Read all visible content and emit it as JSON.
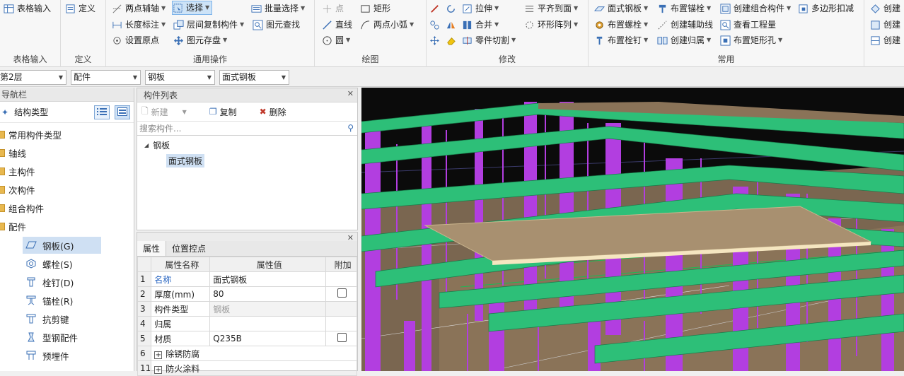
{
  "ribbon": {
    "groups": [
      {
        "label": "表格输入",
        "buttons": [
          {
            "label": "表格输入"
          }
        ]
      },
      {
        "label": "定义",
        "buttons": [
          {
            "label": "定义"
          }
        ]
      },
      {
        "label": "通用操作",
        "buttons": [
          {
            "label": "两点辅轴"
          },
          {
            "label": "选择"
          },
          {
            "label": "批量选择"
          },
          {
            "label": "长度标注"
          },
          {
            "label": "层间复制构件"
          },
          {
            "label": "图元查找"
          },
          {
            "label": "设置原点"
          },
          {
            "label": "图元存盘"
          }
        ]
      },
      {
        "label": "绘图",
        "buttons": [
          {
            "label": "点"
          },
          {
            "label": "矩形"
          },
          {
            "label": "直线"
          },
          {
            "label": "两点小弧"
          },
          {
            "label": "圆"
          }
        ]
      },
      {
        "label": "修改",
        "buttons": [
          {
            "label": "拉伸"
          },
          {
            "label": "平齐到面"
          },
          {
            "label": "合并"
          },
          {
            "label": "环形阵列"
          },
          {
            "label": "零件切割"
          }
        ]
      },
      {
        "label": "常用",
        "buttons": [
          {
            "label": "面式钢板"
          },
          {
            "label": "布置锚栓"
          },
          {
            "label": "创建组合构件"
          },
          {
            "label": "多边形扣减"
          },
          {
            "label": "布置螺栓"
          },
          {
            "label": "创建辅助线"
          },
          {
            "label": "查看工程量"
          },
          {
            "label": "布置栓钉"
          },
          {
            "label": "创建归属"
          },
          {
            "label": "布置矩形孔"
          }
        ]
      },
      {
        "label": "",
        "buttons": [
          {
            "label": "创建"
          },
          {
            "label": "创建"
          },
          {
            "label": "创建"
          }
        ]
      }
    ]
  },
  "toolbar": {
    "floor": "第2层",
    "category": "配件",
    "type": "钢板",
    "element": "面式钢板"
  },
  "nav": {
    "title": "导航栏",
    "struct_label": "结构类型",
    "folders": [
      "常用构件类型",
      "轴线",
      "主构件",
      "次构件",
      "组合构件",
      "配件"
    ],
    "children": [
      "钢板(G)",
      "螺栓(S)",
      "栓钉(D)",
      "锚栓(R)",
      "抗剪键",
      "型钢配件",
      "预埋件"
    ]
  },
  "component_list": {
    "title": "构件列表",
    "new_label": "新建",
    "copy_label": "复制",
    "delete_label": "删除",
    "search_placeholder": "搜索构件...",
    "tree_parent": "钢板",
    "tree_child": "面式钢板"
  },
  "properties": {
    "tabs": [
      "属性",
      "位置控点"
    ],
    "headers": [
      "属性名称",
      "属性值",
      "附加"
    ],
    "rows": [
      {
        "n": "1",
        "name": "名称",
        "value": "面式钢板"
      },
      {
        "n": "2",
        "name": "厚度(mm)",
        "value": "80"
      },
      {
        "n": "3",
        "name": "构件类型",
        "value": "钢板"
      },
      {
        "n": "4",
        "name": "归属",
        "value": ""
      },
      {
        "n": "5",
        "name": "材质",
        "value": "Q235B"
      },
      {
        "n": "6",
        "name": "除锈防腐",
        "value": ""
      },
      {
        "n": "11",
        "name": "防火涂料",
        "value": ""
      }
    ]
  },
  "colors": {
    "beam": "#2dbf78",
    "column": "#b23ee0",
    "floor": "#8a7358",
    "plate": "#a89070",
    "accent": "#cde3f7"
  }
}
